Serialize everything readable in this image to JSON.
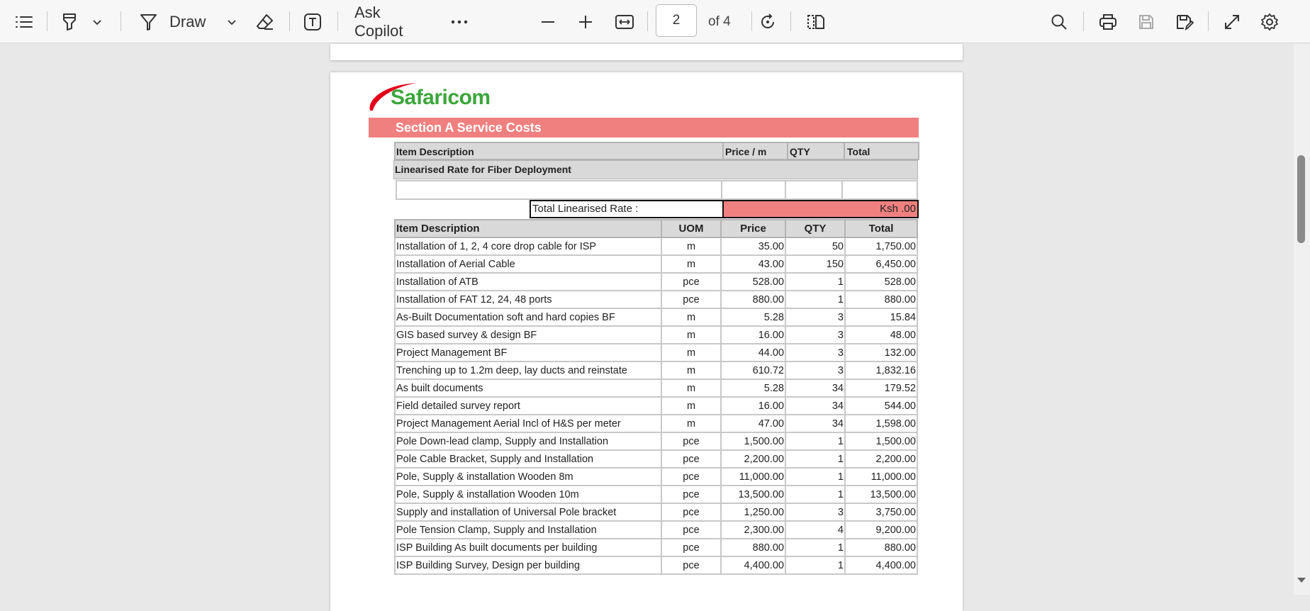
{
  "toolbar": {
    "draw_label": "Draw",
    "ask_copilot_label": "Ask Copilot",
    "page_current": "2",
    "page_total_label": "of 4",
    "icons": [
      "contents-icon",
      "highlighter-icon",
      "chevron-down-icon",
      "draw-pen-icon",
      "chevron-down-icon",
      "eraser-icon",
      "text-box-icon",
      "more-icon",
      "zoom-out-icon",
      "zoom-in-icon",
      "fit-width-icon",
      "rotate-icon",
      "page-view-icon",
      "search-icon",
      "print-icon",
      "save-icon",
      "save-as-icon",
      "fullscreen-icon",
      "settings-icon"
    ]
  },
  "document": {
    "logo_text": "Safaricom",
    "brand_color": "#3aa63a",
    "accent_color": "#f08080",
    "section_title": "Section A Service Costs",
    "header1": {
      "item_description": "Item Description",
      "price_per_m": "Price / m",
      "qty": "QTY",
      "total": "Total"
    },
    "linearised_label": "Linearised Rate for Fiber Deployment",
    "total_linearised_label": "Total Linearised Rate :",
    "total_linearised_value": "Ksh .00",
    "table_headers": [
      "Item Description",
      "UOM",
      "Price",
      "QTY",
      "Total"
    ],
    "rows": [
      {
        "desc": "Installation of 1, 2, 4 core drop cable for ISP",
        "uom": "m",
        "price": "35.00",
        "qty": "50",
        "total": "1,750.00"
      },
      {
        "desc": "Installation of Aerial Cable",
        "uom": "m",
        "price": "43.00",
        "qty": "150",
        "total": "6,450.00"
      },
      {
        "desc": "Installation of ATB",
        "uom": "pce",
        "price": "528.00",
        "qty": "1",
        "total": "528.00"
      },
      {
        "desc": "Installation of FAT 12, 24, 48 ports",
        "uom": "pce",
        "price": "880.00",
        "qty": "1",
        "total": "880.00"
      },
      {
        "desc": "As-Built Documentation soft and hard copies BF",
        "uom": "m",
        "price": "5.28",
        "qty": "3",
        "total": "15.84"
      },
      {
        "desc": "GIS based survey & design BF",
        "uom": "m",
        "price": "16.00",
        "qty": "3",
        "total": "48.00"
      },
      {
        "desc": "Project Management BF",
        "uom": "m",
        "price": "44.00",
        "qty": "3",
        "total": "132.00"
      },
      {
        "desc": "Trenching up to 1.2m deep, lay ducts and reinstate",
        "uom": "m",
        "price": "610.72",
        "qty": "3",
        "total": "1,832.16"
      },
      {
        "desc": " As built documents",
        "uom": "m",
        "price": "5.28",
        "qty": "34",
        "total": "179.52"
      },
      {
        "desc": " Field detailed survey report",
        "uom": "m",
        "price": "16.00",
        "qty": "34",
        "total": "544.00"
      },
      {
        "desc": "Project Management Aerial Incl of H&S per meter",
        "uom": "m",
        "price": "47.00",
        "qty": "34",
        "total": "1,598.00"
      },
      {
        "desc": "Pole Down-lead clamp, Supply and Installation",
        "uom": "pce",
        "price": "1,500.00",
        "qty": "1",
        "total": "1,500.00"
      },
      {
        "desc": "Pole Cable Bracket, Supply and Installation",
        "uom": "pce",
        "price": "2,200.00",
        "qty": "1",
        "total": "2,200.00"
      },
      {
        "desc": "Pole, Supply & installation Wooden 8m",
        "uom": "pce",
        "price": "11,000.00",
        "qty": "1",
        "total": "11,000.00"
      },
      {
        "desc": "Pole, Supply & installation Wooden 10m",
        "uom": "pce",
        "price": "13,500.00",
        "qty": "1",
        "total": "13,500.00"
      },
      {
        "desc": "Supply and installation of Universal Pole bracket",
        "uom": "pce",
        "price": "1,250.00",
        "qty": "3",
        "total": "3,750.00"
      },
      {
        "desc": "Pole Tension Clamp, Supply and Installation",
        "uom": "pce",
        "price": "2,300.00",
        "qty": "4",
        "total": "9,200.00"
      },
      {
        "desc": "ISP Building As built documents per building",
        "uom": "pce",
        "price": "880.00",
        "qty": "1",
        "total": "880.00"
      },
      {
        "desc": "ISP Building Survey, Design per building",
        "uom": "pce",
        "price": "4,400.00",
        "qty": "1",
        "total": "4,400.00"
      }
    ]
  }
}
